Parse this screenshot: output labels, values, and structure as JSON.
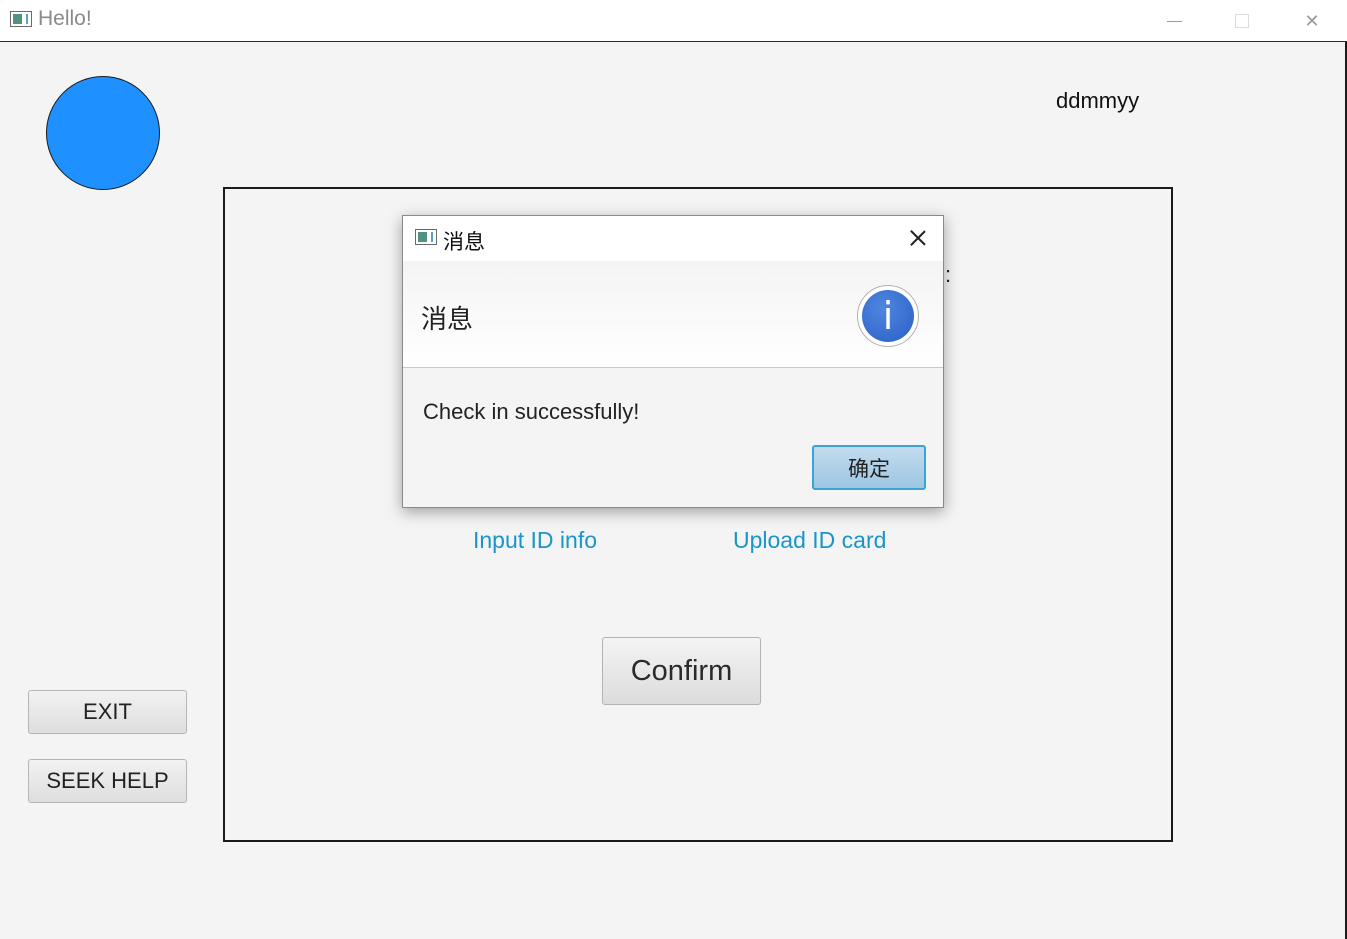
{
  "window": {
    "title": "Hello!",
    "icons": {
      "app": "app-window-icon",
      "minimize": "minimize-icon",
      "maximize": "maximize-icon",
      "close": "close-icon"
    }
  },
  "header": {
    "avatar_color": "#1e90ff",
    "date_format": "ddmmyy"
  },
  "sidebar": {
    "exit_label": "EXIT",
    "help_label": "SEEK HELP"
  },
  "main": {
    "separator": ":",
    "link_input": "Input ID info",
    "link_upload": "Upload ID card",
    "confirm_label": "Confirm",
    "link_color": "#1a95c9"
  },
  "dialog": {
    "title": "消息",
    "header_text": "消息",
    "icon": "info-icon",
    "message": "Check in successfully!",
    "ok_label": "确定"
  }
}
